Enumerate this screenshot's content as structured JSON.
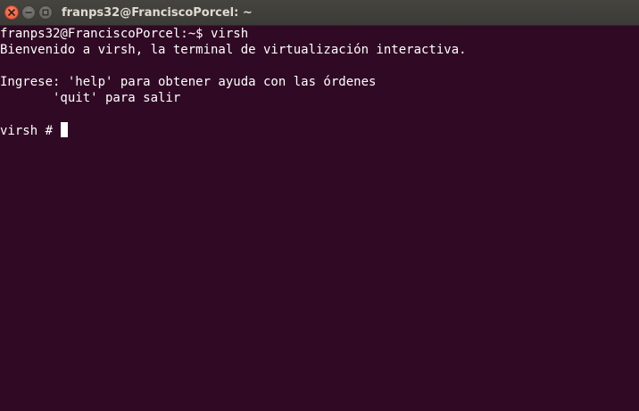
{
  "window": {
    "title": "franps32@FranciscoPorcel: ~",
    "close_icon": "close-icon",
    "minimize_icon": "minimize-icon",
    "maximize_icon": "maximize-icon"
  },
  "terminal": {
    "lines": [
      "franps32@FranciscoPorcel:~$ virsh",
      "Bienvenido a virsh, la terminal de virtualización interactiva.",
      "",
      "Ingrese: 'help' para obtener ayuda con las órdenes",
      "       'quit' para salir",
      ""
    ],
    "prompt": "virsh # "
  },
  "colors": {
    "background": "#300a24",
    "text": "#ffffff",
    "titlebar": "#3c3b37",
    "close_button": "#e65a3c"
  }
}
